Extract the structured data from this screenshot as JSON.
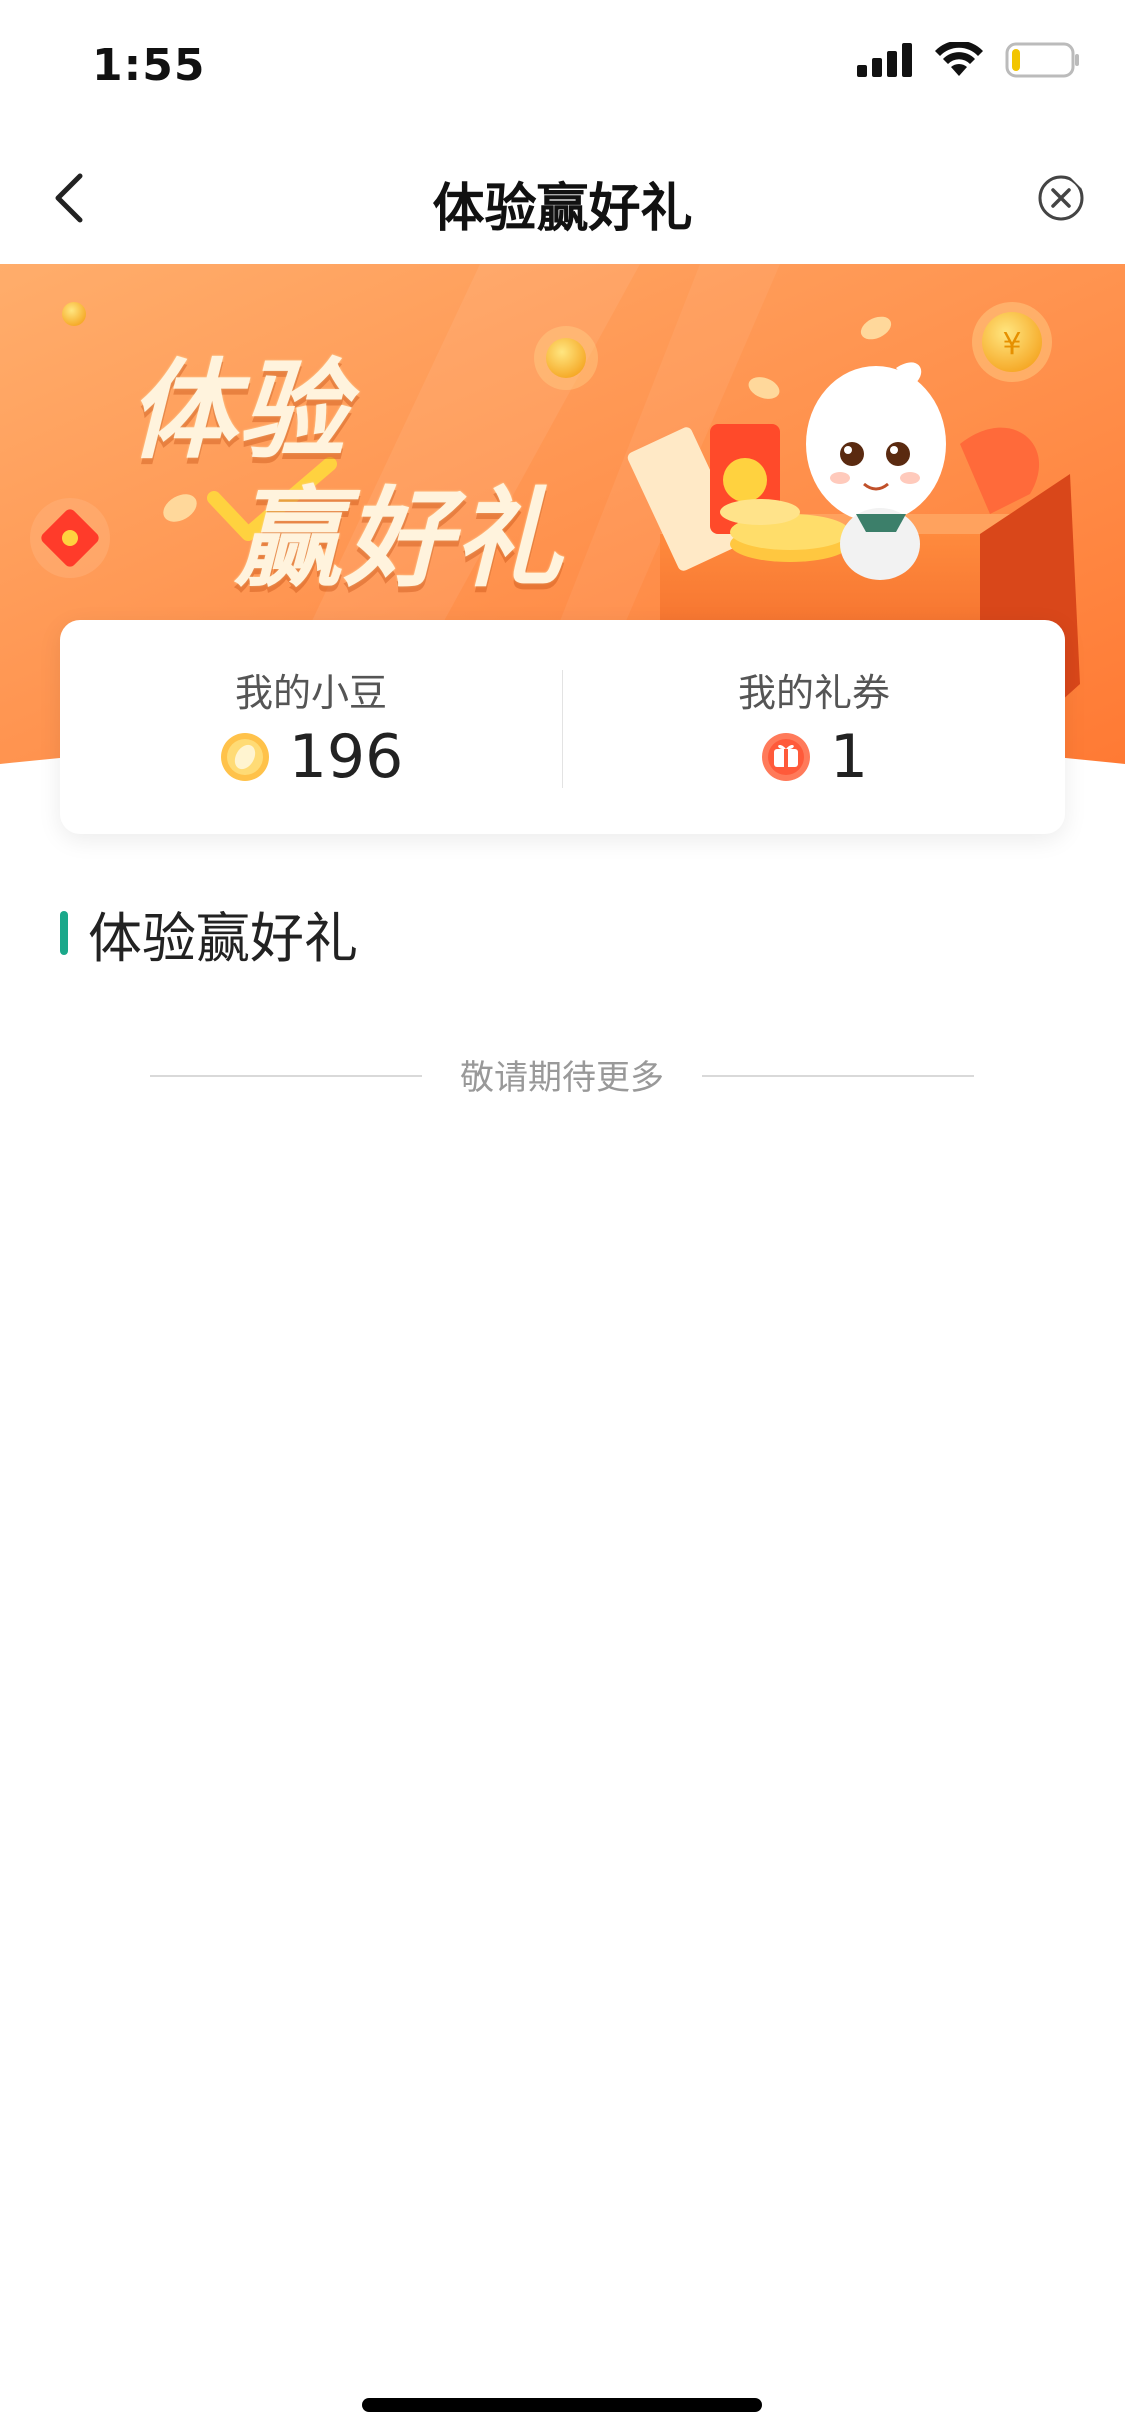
{
  "status_bar": {
    "time": "1:55",
    "icons": [
      "signal-icon",
      "wifi-icon",
      "battery-icon"
    ],
    "battery_level": 0.15
  },
  "nav": {
    "title": "体验赢好礼",
    "back_icon": "chevron-left-icon",
    "close_icon": "close-circle-icon"
  },
  "banner": {
    "line1": "体验",
    "line2": "赢好礼",
    "colors": {
      "start": "#ff9a55",
      "end": "#ff7a30"
    }
  },
  "stats": {
    "beans": {
      "label": "我的小豆",
      "value": "196",
      "icon": "bean-coin-icon"
    },
    "coupons": {
      "label": "我的礼券",
      "value": "1",
      "icon": "gift-coupon-icon"
    }
  },
  "section": {
    "title": "体验赢好礼",
    "accent": "#1aa88a"
  },
  "footer_note": "敬请期待更多"
}
